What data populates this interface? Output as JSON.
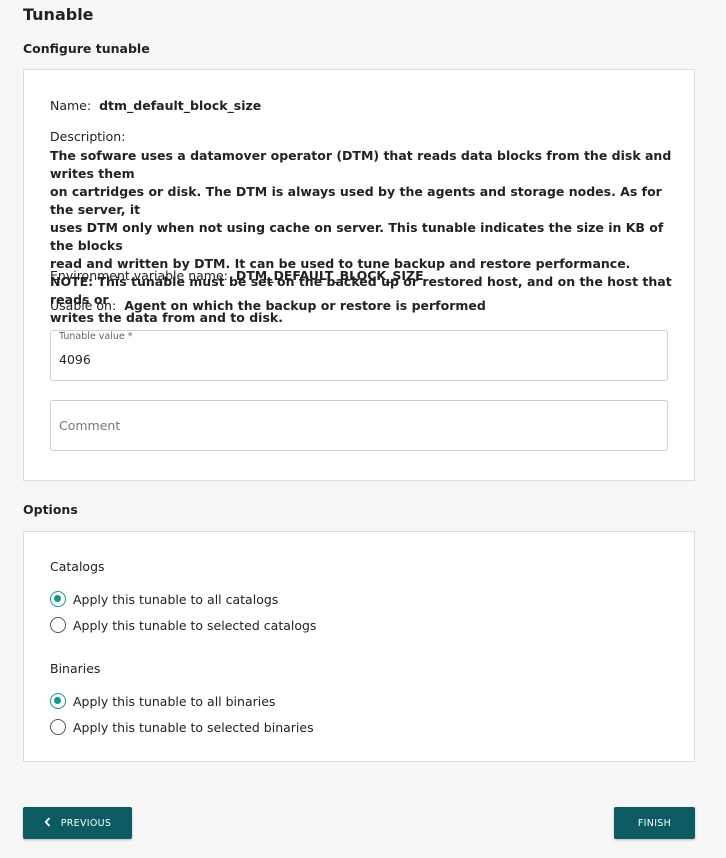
{
  "page": {
    "title": "Tunable",
    "configure_title": "Configure tunable",
    "options_title": "Options"
  },
  "config": {
    "name_label": "Name:",
    "name_value": "dtm_default_block_size",
    "description_label": "Description:",
    "description_lines": [
      "The sofware uses a datamover operator (DTM) that reads data blocks from the disk and writes them",
      "on cartridges or disk. The DTM is always used by the agents and storage nodes. As for the server, it",
      "uses DTM only when not using cache on server. This tunable indicates the size in KB of the blocks",
      "read and written by DTM. It can be used to tune backup and restore performance.",
      "NOTE: This tunable must be set on the backed up or restored host, and on the host that reads or",
      "writes the data from and to disk."
    ],
    "env_label": "Environment variable name:",
    "env_value": "DTM_DEFAULT_BLOCK_SIZE",
    "usable_label": "Usable on:",
    "usable_value": "Agent on which the backup or restore is performed",
    "tunable_value_label": "Tunable value *",
    "tunable_value": "4096",
    "comment_placeholder": "Comment",
    "comment_value": ""
  },
  "options": {
    "catalogs_label": "Catalogs",
    "catalogs": [
      {
        "label": "Apply this tunable to all catalogs",
        "checked": true
      },
      {
        "label": "Apply this tunable to selected catalogs",
        "checked": false
      }
    ],
    "binaries_label": "Binaries",
    "binaries": [
      {
        "label": "Apply this tunable to all binaries",
        "checked": true
      },
      {
        "label": "Apply this tunable to selected binaries",
        "checked": false
      }
    ]
  },
  "footer": {
    "previous_label": "PREVIOUS",
    "finish_label": "FINISH"
  },
  "colors": {
    "accent": "#14968d",
    "button_bg": "#0c5b63",
    "page_bg": "#f7f7f7"
  },
  "icons": {
    "previous": "chevron-left-icon"
  }
}
